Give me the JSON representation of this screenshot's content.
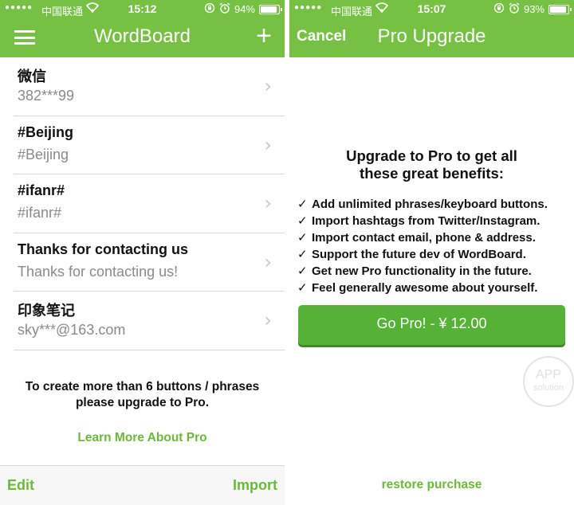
{
  "left": {
    "status": {
      "carrier": "中国联通",
      "time": "15:12",
      "battery": "94%",
      "battery_level": 0.94
    },
    "nav": {
      "title": "WordBoard"
    },
    "items": [
      {
        "title": "微信",
        "subtitle": "382***99"
      },
      {
        "title": "#Beijing",
        "subtitle": "#Beijing"
      },
      {
        "title": "#ifanr#",
        "subtitle": "#ifanr#"
      },
      {
        "title": "Thanks for contacting us",
        "subtitle": "Thanks for contacting us!"
      },
      {
        "title": "印象笔记",
        "subtitle": "sky***@163.com"
      }
    ],
    "note_line1": "To create more than 6 buttons / phrases",
    "note_line2": "please upgrade to Pro.",
    "learn_more": "Learn More About Pro",
    "toolbar": {
      "edit": "Edit",
      "import": "Import"
    }
  },
  "right": {
    "status": {
      "carrier": "中国联通",
      "time": "15:07",
      "battery": "93%",
      "battery_level": 0.93
    },
    "nav": {
      "title": "Pro Upgrade",
      "cancel": "Cancel"
    },
    "heading_line1": "Upgrade to Pro to get all",
    "heading_line2": "these great benefits:",
    "check_glyph": "✓",
    "benefits": [
      "Add unlimited phrases/keyboard buttons.",
      "Import hashtags from Twitter/Instagram.",
      "Import contact email, phone & address.",
      "Support the future dev of WordBoard.",
      "Get new Pro functionality in the future.",
      "Feel generally awesome about yourself."
    ],
    "gopro_label": "Go Pro! -  ¥ 12.00",
    "watermark_top": "APP",
    "watermark_bottom": "solution",
    "restore": "restore purchase"
  },
  "colors": {
    "accent": "#76c043",
    "link": "#6cb83a",
    "button": "#55b236"
  }
}
